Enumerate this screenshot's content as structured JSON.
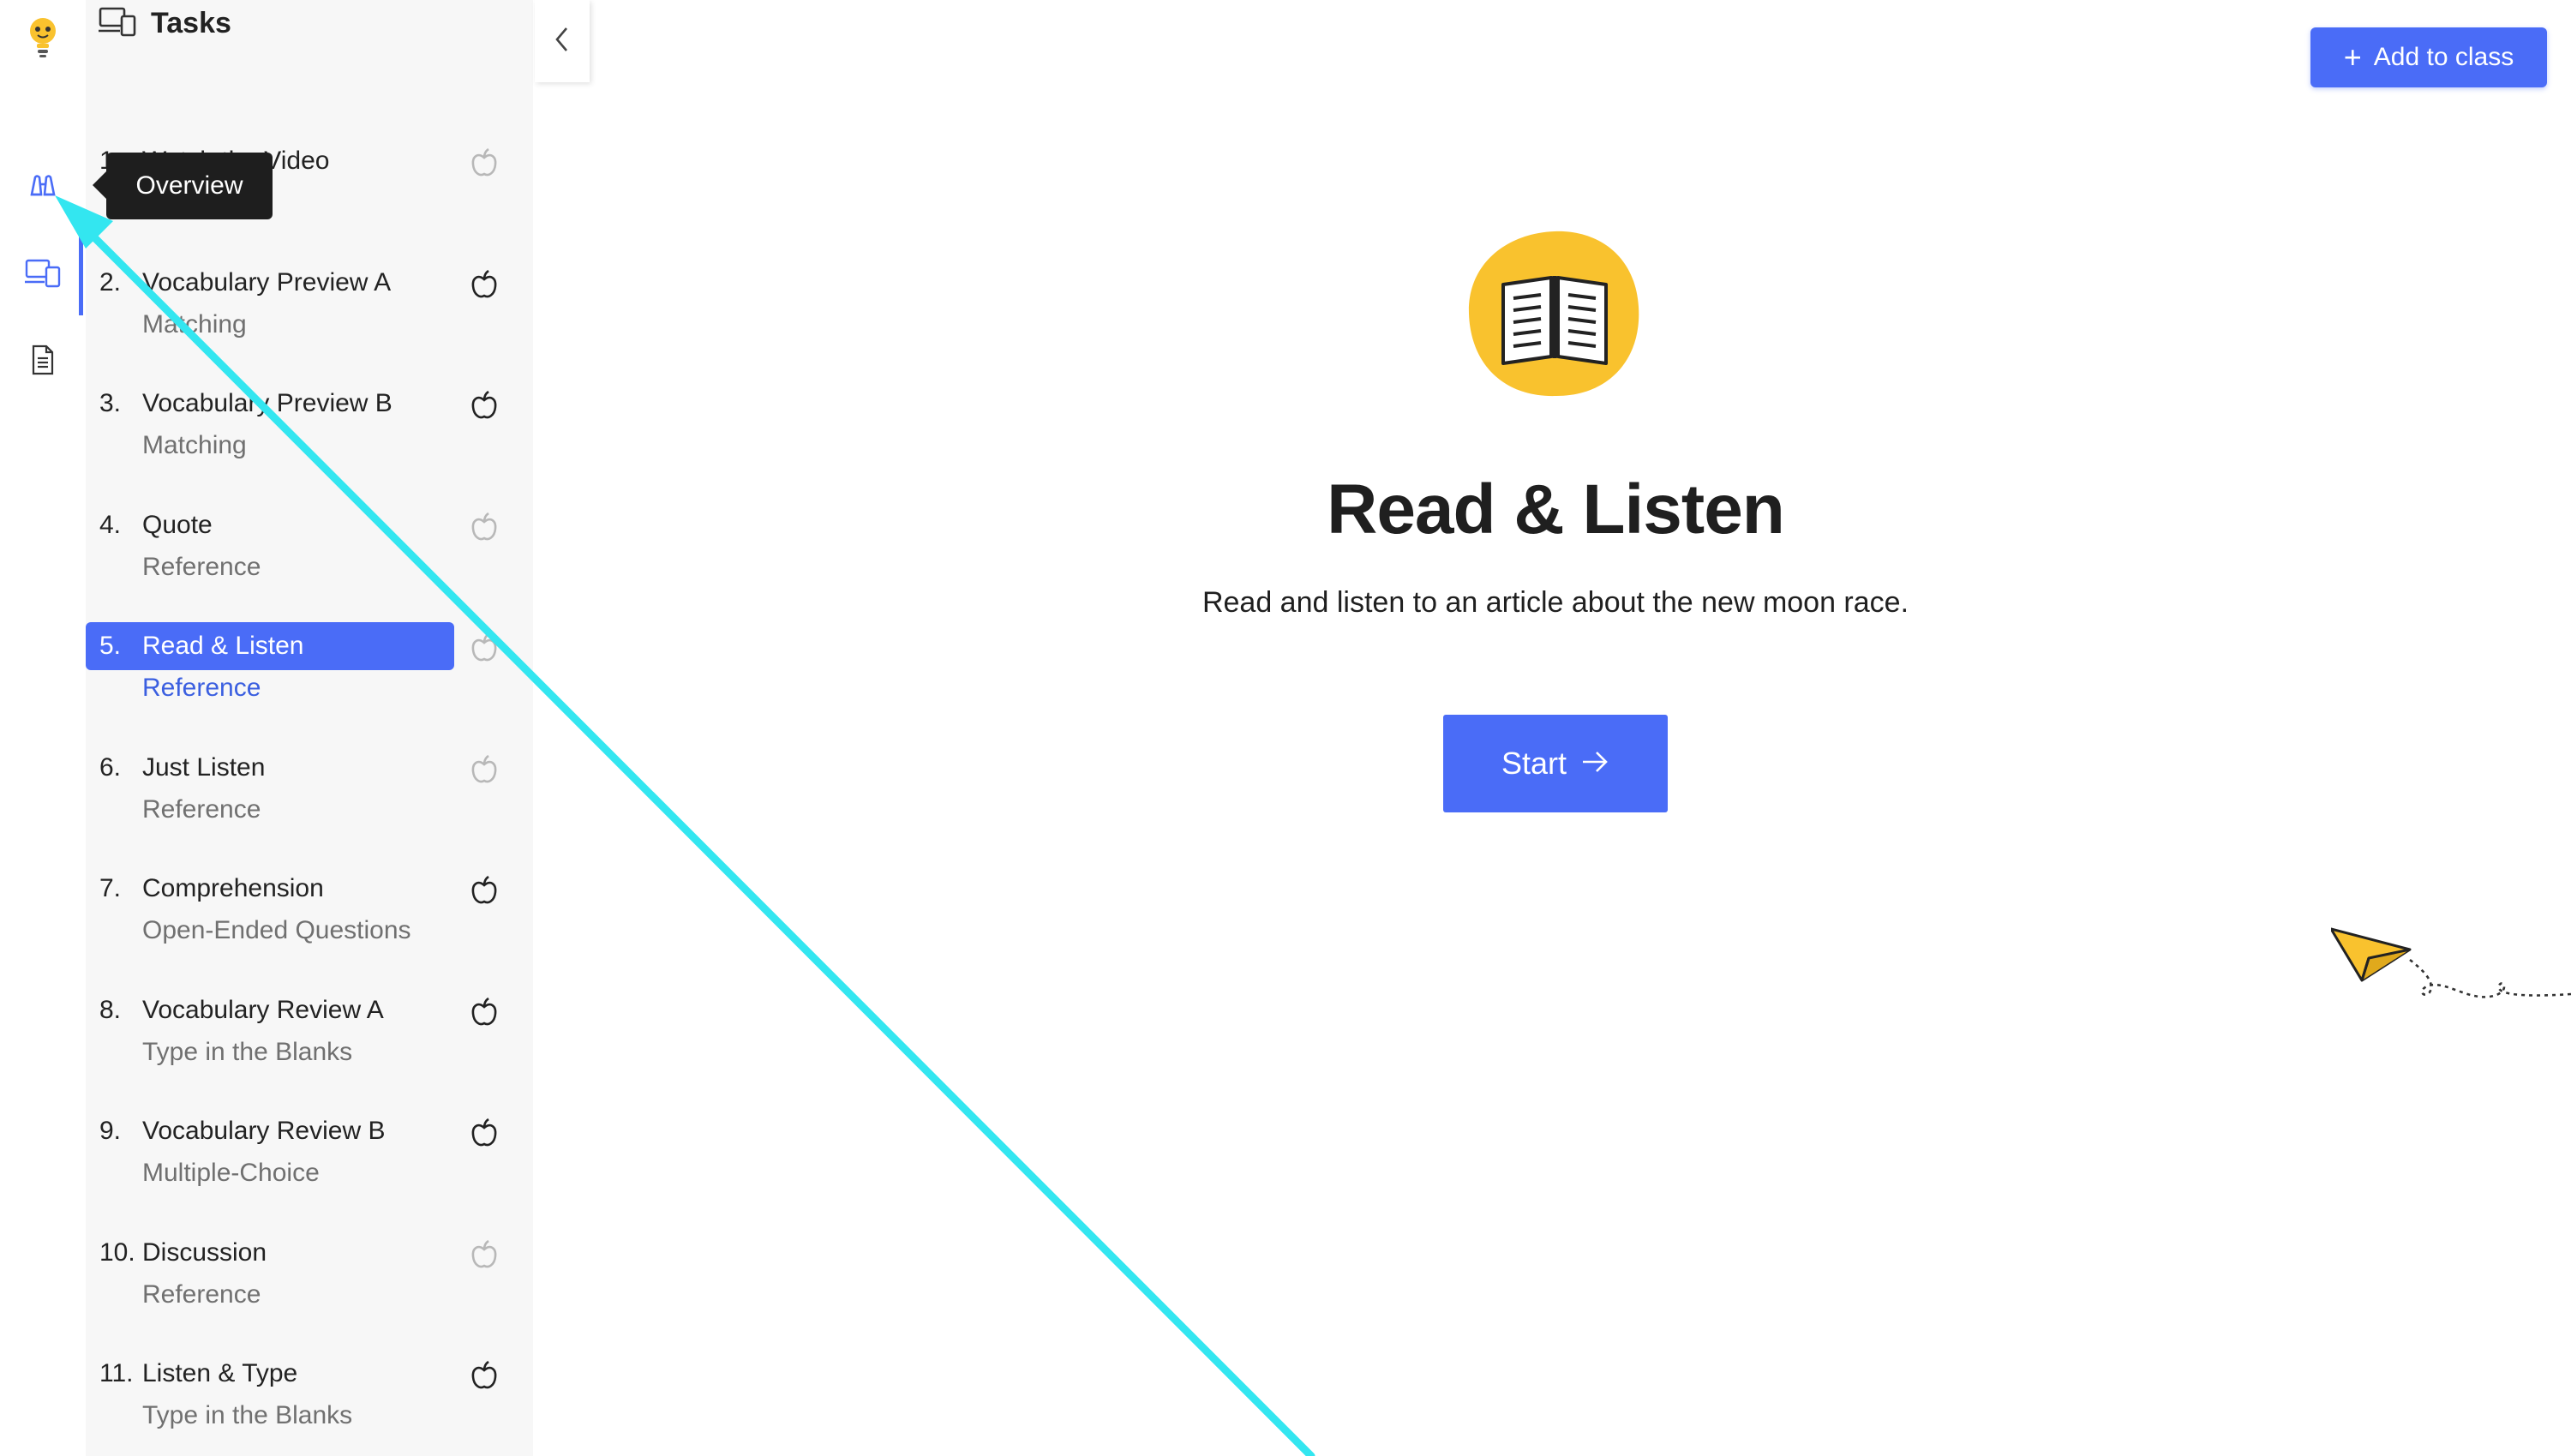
{
  "sidebar_rail": {
    "items": [
      {
        "icon": "lightbulb-icon"
      },
      {
        "icon": "binoculars-icon"
      },
      {
        "icon": "devices-icon"
      },
      {
        "icon": "document-icon"
      }
    ],
    "tooltip": "Overview"
  },
  "tasks_panel": {
    "title": "Tasks",
    "tasks": [
      {
        "num": "1.",
        "name": "Watch the Video",
        "sub": "",
        "done": false
      },
      {
        "num": "2.",
        "name": "Vocabulary Preview A",
        "sub": "Matching",
        "done": true
      },
      {
        "num": "3.",
        "name": "Vocabulary Preview B",
        "sub": "Matching",
        "done": true
      },
      {
        "num": "4.",
        "name": "Quote",
        "sub": "Reference",
        "done": false
      },
      {
        "num": "5.",
        "name": "Read & Listen",
        "sub": "Reference",
        "done": false,
        "active": true
      },
      {
        "num": "6.",
        "name": "Just Listen",
        "sub": "Reference",
        "done": false
      },
      {
        "num": "7.",
        "name": "Comprehension",
        "sub": "Open-Ended Questions",
        "done": true
      },
      {
        "num": "8.",
        "name": "Vocabulary Review A",
        "sub": "Type in the Blanks",
        "done": true
      },
      {
        "num": "9.",
        "name": "Vocabulary Review B",
        "sub": "Multiple-Choice",
        "done": true
      },
      {
        "num": "10.",
        "name": "Discussion",
        "sub": "Reference",
        "done": false
      },
      {
        "num": "11.",
        "name": "Listen & Type",
        "sub": "Type in the Blanks",
        "done": true
      }
    ]
  },
  "header": {
    "add_to_class": "Add to class"
  },
  "main": {
    "icon": "open-book-icon",
    "title": "Read & Listen",
    "description": "Read and listen to an article about the new moon race.",
    "start_label": "Start"
  },
  "colors": {
    "accent": "#4a6cf7",
    "icon_yellow": "#f9c22e",
    "annotation_cyan": "#33e6f0"
  }
}
